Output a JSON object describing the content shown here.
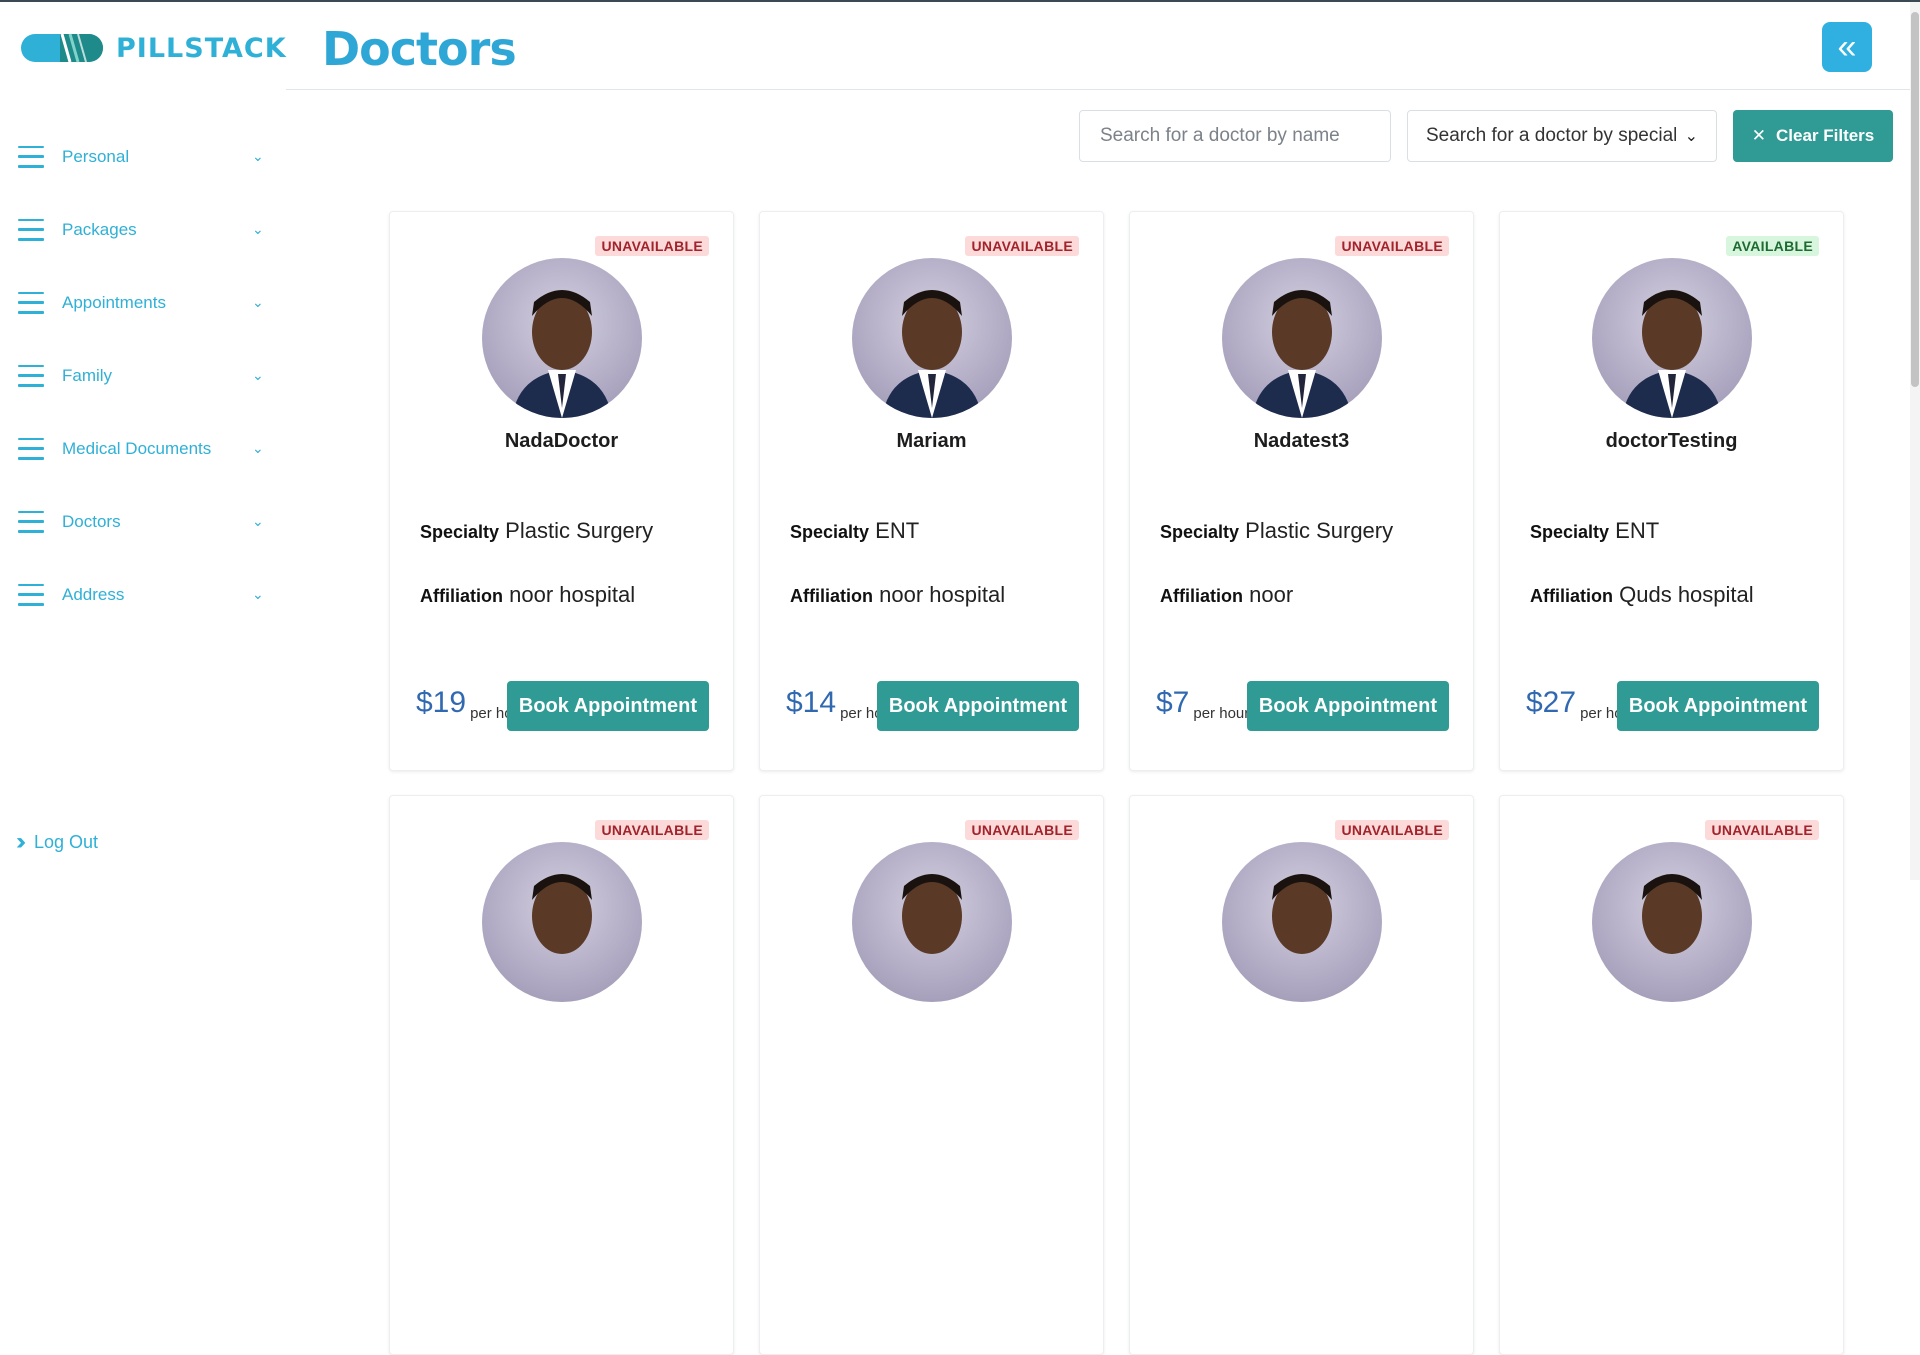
{
  "app": {
    "name": "PILLSTACK",
    "accent": "#2fb0d6",
    "button_color": "#2f9b94"
  },
  "header": {
    "title": "Doctors",
    "collapse_icon": "double-chevron-left-icon"
  },
  "sidebar": {
    "items": [
      {
        "label": "Personal"
      },
      {
        "label": "Packages"
      },
      {
        "label": "Appointments"
      },
      {
        "label": "Family"
      },
      {
        "label": "Medical Documents"
      },
      {
        "label": "Doctors"
      },
      {
        "label": "Address"
      }
    ],
    "logout_label": "Log Out"
  },
  "filters": {
    "name_placeholder": "Search for a doctor by name",
    "specialty_selected": "Search for a doctor by specialty",
    "clear_label": "Clear Filters"
  },
  "cards": {
    "specialty_label": "Specialty",
    "affiliation_label": "Affiliation",
    "per_label": "per hour",
    "book_label": "Book Appointment",
    "items": [
      {
        "status": "UNAVAILABLE",
        "name": "NadaDoctor",
        "specialty": "Plastic Surgery",
        "affiliation": "noor hospital",
        "price": "$19"
      },
      {
        "status": "UNAVAILABLE",
        "name": "Mariam",
        "specialty": "ENT",
        "affiliation": "noor hospital",
        "price": "$14"
      },
      {
        "status": "UNAVAILABLE",
        "name": "Nadatest3",
        "specialty": "Plastic Surgery",
        "affiliation": "noor",
        "price": "$7"
      },
      {
        "status": "AVAILABLE",
        "name": "doctorTesting",
        "specialty": "ENT",
        "affiliation": "Quds hospital",
        "price": "$27"
      },
      {
        "status": "UNAVAILABLE"
      },
      {
        "status": "UNAVAILABLE"
      },
      {
        "status": "UNAVAILABLE"
      },
      {
        "status": "UNAVAILABLE"
      }
    ]
  }
}
